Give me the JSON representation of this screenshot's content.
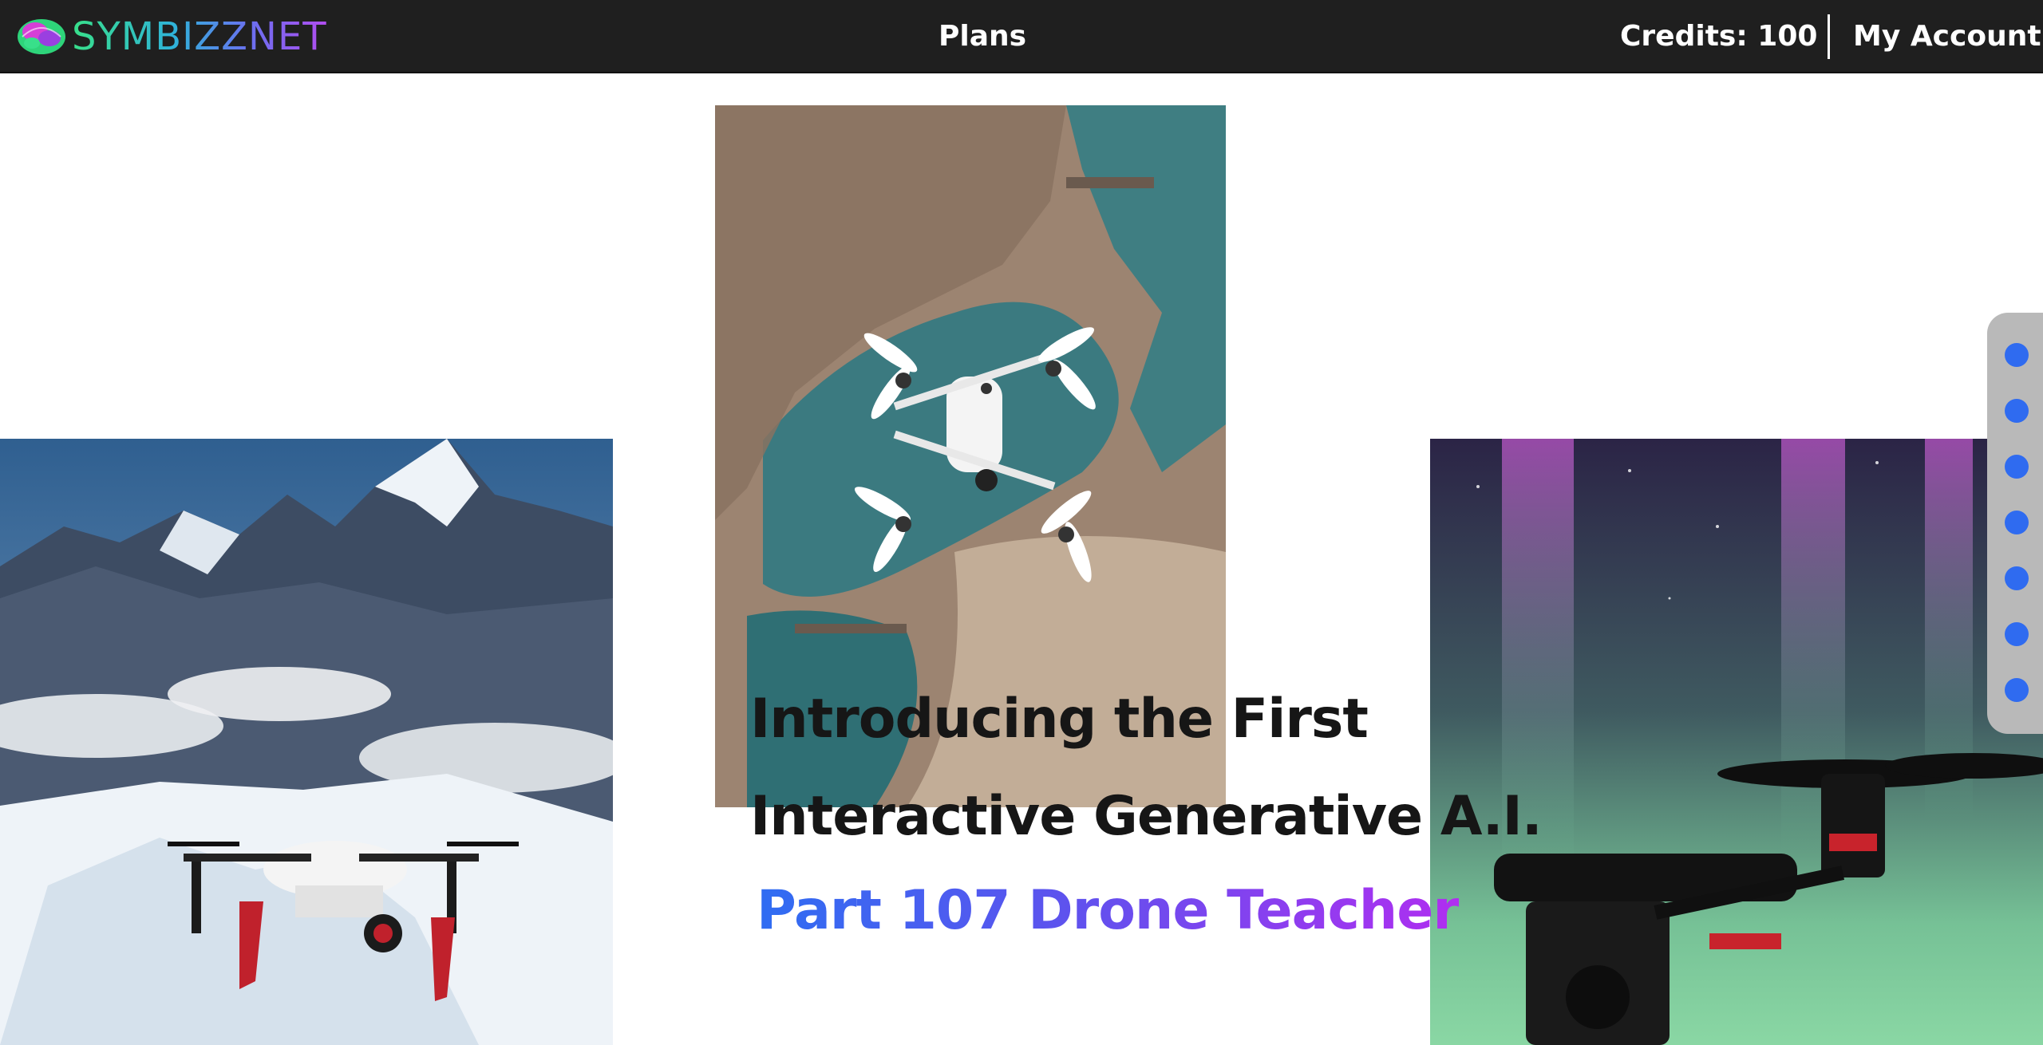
{
  "header": {
    "logo_text": "SYMBIZZNET",
    "plans_label": "Plans",
    "credits_label": "Credits:",
    "credits_value": "100",
    "account_label": "My Account"
  },
  "hero": {
    "line1": "Introducing the First",
    "line2": "Interactive Generative A.I.",
    "subtitle": "Part 107 Drone Teacher"
  },
  "images": {
    "left": "drone-over-snowy-mountains",
    "center": "drone-over-canyon-lake",
    "right": "drone-under-aurora"
  },
  "side_nav": {
    "dot_count": 7
  },
  "colors": {
    "topbar": "#1f1f1f",
    "accent_blue": "#2f6bf0",
    "accent_purple": "#b02ef0",
    "logo_green": "#38e08a"
  }
}
